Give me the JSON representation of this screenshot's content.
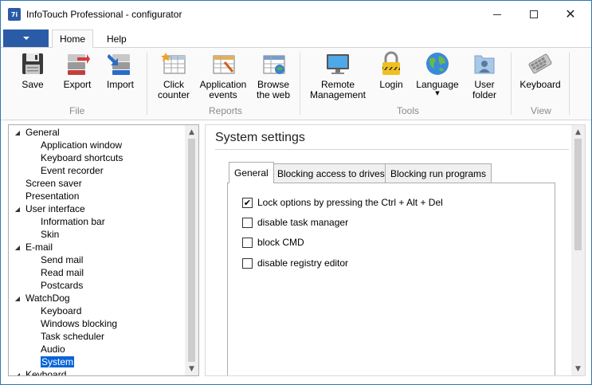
{
  "window": {
    "title": "InfoTouch Professional - configurator",
    "icon_text": "7i"
  },
  "ribbon": {
    "tabs": [
      {
        "label": "Home",
        "active": true
      },
      {
        "label": "Help",
        "active": false
      }
    ],
    "buttons": {
      "save": "Save",
      "export": "Export",
      "import": "Import",
      "click_counter": "Click counter",
      "application_events": "Application events",
      "browse_the_web": "Browse the web",
      "remote_management": "Remote Management",
      "login": "Login",
      "language": "Language",
      "user_folder": "User folder",
      "keyboard": "Keyboard"
    },
    "groups": {
      "file": "File",
      "reports": "Reports",
      "tools": "Tools",
      "view": "View"
    }
  },
  "tree": {
    "items": [
      {
        "label": "General",
        "level": 0,
        "expanded": true
      },
      {
        "label": "Application window",
        "level": 1
      },
      {
        "label": "Keyboard shortcuts",
        "level": 1
      },
      {
        "label": "Event recorder",
        "level": 1
      },
      {
        "label": "Screen saver",
        "level": 0
      },
      {
        "label": "Presentation",
        "level": 0
      },
      {
        "label": "User interface",
        "level": 0,
        "expanded": true
      },
      {
        "label": "Information bar",
        "level": 1
      },
      {
        "label": "Skin",
        "level": 1
      },
      {
        "label": "E-mail",
        "level": 0,
        "expanded": true
      },
      {
        "label": "Send mail",
        "level": 1
      },
      {
        "label": "Read mail",
        "level": 1
      },
      {
        "label": "Postcards",
        "level": 1
      },
      {
        "label": "WatchDog",
        "level": 0,
        "expanded": true
      },
      {
        "label": "Keyboard",
        "level": 1
      },
      {
        "label": "Windows blocking",
        "level": 1
      },
      {
        "label": "Task scheduler",
        "level": 1
      },
      {
        "label": "Audio",
        "level": 1
      },
      {
        "label": "System",
        "level": 1,
        "selected": true
      },
      {
        "label": "Keyboard",
        "level": 0,
        "expanded": true
      }
    ]
  },
  "content": {
    "title": "System settings",
    "tabs": [
      {
        "label": "General",
        "active": true
      },
      {
        "label": "Blocking access to drives",
        "active": false
      },
      {
        "label": "Blocking run programs",
        "active": false
      }
    ],
    "options": [
      {
        "label": "Lock options by pressing the Ctrl + Alt + Del",
        "checked": true
      },
      {
        "label": "disable task manager",
        "checked": false
      },
      {
        "label": "block CMD",
        "checked": false
      },
      {
        "label": "disable registry editor",
        "checked": false
      }
    ]
  },
  "colors": {
    "accent": "#2a5ba7",
    "selection": "#0a64d6",
    "window_border": "#2b78b6"
  }
}
